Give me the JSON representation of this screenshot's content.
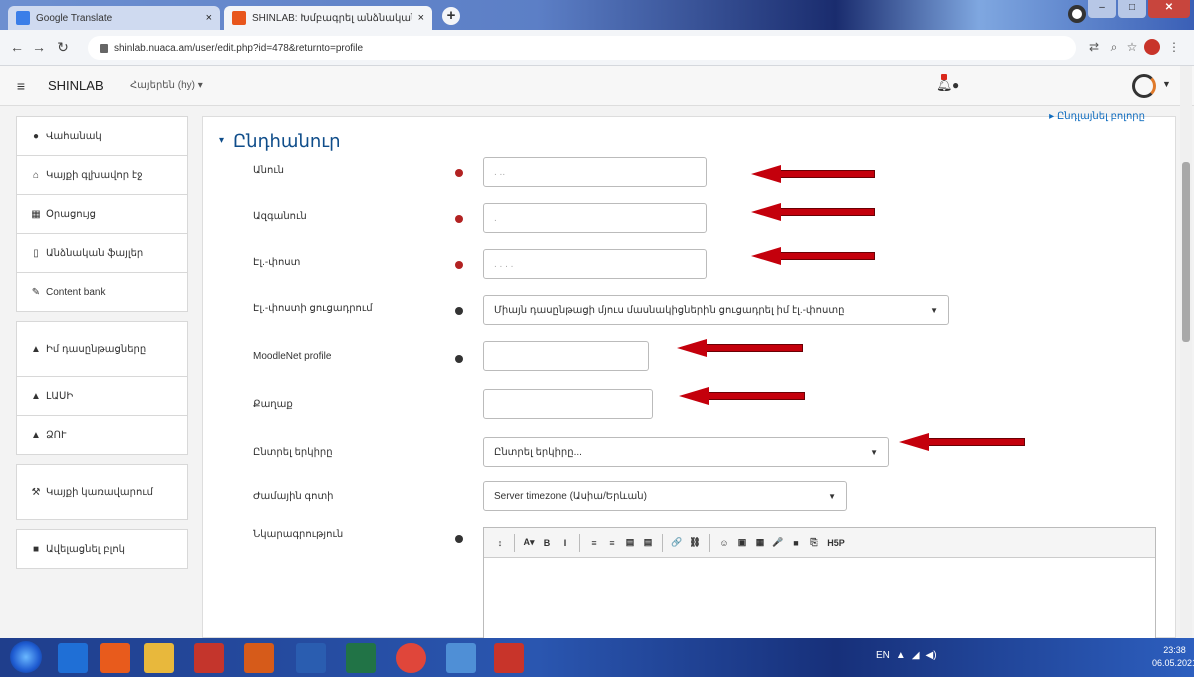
{
  "browser": {
    "tabs": [
      {
        "title": "Google Translate",
        "close": "×"
      },
      {
        "title": "SHINLAB: Խմբագրել անձնական",
        "close": "×"
      }
    ],
    "url": "shinlab.nuaca.am/user/edit.php?id=478&returnto=profile"
  },
  "navbar": {
    "brand": "SHINLAB",
    "language": "Հայերեն (hy) ▾"
  },
  "sidebar": {
    "items": [
      {
        "icon": "dashboard-icon",
        "label": "Վահանակ"
      },
      {
        "icon": "home-icon",
        "label": "Կայքի գլխավոր էջ"
      },
      {
        "icon": "calendar-icon",
        "label": "Օրացույց"
      },
      {
        "icon": "file-icon",
        "label": "Անձնական ֆայլեր"
      },
      {
        "icon": "pencil-icon",
        "label": "Content bank"
      },
      {
        "icon": "graduation-cap-icon",
        "label": "Իմ դասընթացները"
      },
      {
        "icon": "graduation-cap-icon",
        "label": "ԼԱՍԻ"
      },
      {
        "icon": "graduation-cap-icon",
        "label": "ՁՈՒ"
      },
      {
        "icon": "wrench-icon",
        "label": "Կայքի կառավարում"
      },
      {
        "icon": "block-icon",
        "label": "Ավելացնել բլոկ"
      }
    ]
  },
  "form": {
    "expand_all": "▸ Ընդլայնել բոլորը",
    "section_title": "Ընդհանուր",
    "fields": {
      "firstname": {
        "label": "Անուն",
        "value": ". .."
      },
      "lastname": {
        "label": "Ազգանուն",
        "value": "."
      },
      "email": {
        "label": "Էլ.-փոստ",
        "value": ". .  .   ."
      },
      "email_display": {
        "label": "Էլ.-փոստի ցուցադրում",
        "value": "Միայն դասընթացի մյուս մասնակիցներին ցուցադրել իմ էլ.-փոստը"
      },
      "moodlenet": {
        "label": "MoodleNet profile",
        "value": ""
      },
      "city": {
        "label": "Քաղաք",
        "value": ""
      },
      "country": {
        "label": "Ընտրել երկիրը",
        "value": "Ընտրել երկիրը..."
      },
      "timezone": {
        "label": "Ժամային գոտի",
        "value": "Server timezone (Ասիա/Երևան)"
      },
      "description": {
        "label": "Նկարագրություն"
      }
    },
    "toolbar": [
      "↕",
      "A▾",
      "B",
      "I",
      "≡",
      "≡",
      "▤",
      "▤",
      "🔗",
      "⛓",
      "☺",
      "▣",
      "▦",
      "🎤",
      "■",
      "⎘",
      "H5P"
    ]
  },
  "taskbar": {
    "tray_lang": "EN",
    "time": "23:38",
    "date": "06.05.2021"
  },
  "colors": {
    "accent": "#0f4d8a",
    "arrow": "#c4000c",
    "required": "#b22222"
  }
}
